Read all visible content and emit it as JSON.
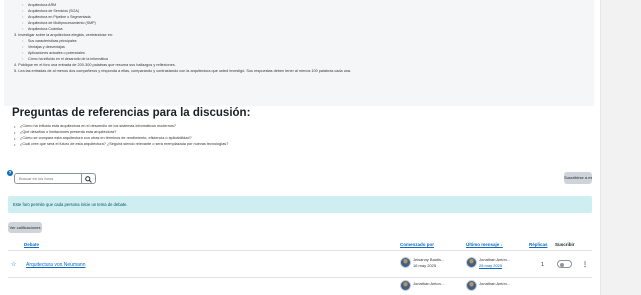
{
  "intro": {
    "sub_items_top": [
      "Arquitectura ARM",
      "Arquitectura de Servicios (SOA)",
      "Arquitectura en Pipeline o Segmentada",
      "Arquitectura de Multiprocesamiento (SMP)",
      "Arquitectura Cuántica"
    ],
    "step3": "3. Investigar sobre la arquitectura elegida, centrándose en:",
    "step3_items": [
      "Sus características principales",
      "Ventajas y desventajas",
      "Aplicaciones actuales o potenciales",
      "Cómo ha influido en el desarrollo de la informática"
    ],
    "step4": "4. Publique en el foro una entrada de 200-300 palabras que resuma sus hallazgos y reflexiones.",
    "step5": "5. Lea las entradas de al menos dos compañeros y responda a ellas, comparando y contrastando con la arquitectura que usted investigó. Sus respuestas deben tener al menos 100 palabras cada una."
  },
  "discussion": {
    "heading": "Preguntas de referencias para la discusión:",
    "questions": [
      "¿Cómo ha influido esta arquitectura en el desarrollo de los sistemas informáticos modernos?",
      "¿Qué desafíos o limitaciones presenta esta arquitectura?",
      "¿Cómo se compara esta arquitectura con otras en términos de rendimiento, eficiencia o aplicabilidad?",
      "¿Cuál cree que será el futuro de esta arquitectura? ¿Seguirá siendo relevante o será reemplazada por nuevas tecnologías?"
    ]
  },
  "forum": {
    "help_icon": "?",
    "search_placeholder": "Buscar en los foros",
    "search_icon": "magnifier",
    "subscribe_label": "Suscribirse a este foro",
    "info_message": "Este foro permite que cada persona inicie un tema de debate.",
    "grades_label": "Ver calificaciones"
  },
  "table": {
    "headers": {
      "topic": "Debate",
      "started_by": "Comenzado por",
      "last_post": "Último mensaje ↓",
      "replies": "Réplicas",
      "subscribe": "Suscribir"
    },
    "rows": [
      {
        "star_icon": "☆",
        "topic": "Arquitectura von Neumann",
        "started_by_name": "Jeisanny Bautis...",
        "started_by_date": "16 may 2025",
        "last_post_name": "Jonathan Anton...",
        "last_post_date": "28 may 2025",
        "replies": "1",
        "menu_icon": "⋮"
      }
    ],
    "next_row_partial": {
      "started_by_name": "Jonathan Anton...",
      "last_post_name": "Jonathan Anton..."
    }
  },
  "colors": {
    "link": "#0f6cbf",
    "alert_bg": "#cfeef2",
    "button_bg": "#ced4da"
  }
}
